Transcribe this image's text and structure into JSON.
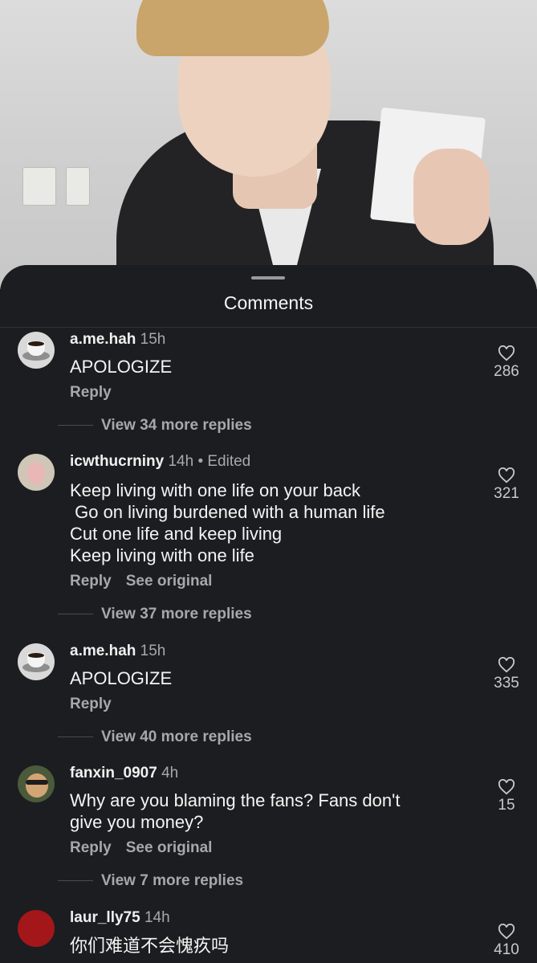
{
  "sheet": {
    "title": "Comments"
  },
  "comments": [
    {
      "username": "a.me.hah",
      "time": "15h",
      "lines": [
        "APOLOGIZE"
      ],
      "actions": {
        "reply": "Reply"
      },
      "likes": "286",
      "view_replies": "View 34 more replies",
      "avatar": "coffee-cup-icon"
    },
    {
      "username": "icwthucrniny",
      "time": "14h • Edited",
      "lines": [
        "Keep living with one life on your back",
        " Go on living burdened with a human life",
        "Cut one life and keep living",
        "Keep living with one life"
      ],
      "actions": {
        "reply": "Reply",
        "see_original": "See original"
      },
      "likes": "321",
      "view_replies": "View 37 more replies",
      "avatar": "pink-figure-icon"
    },
    {
      "username": "a.me.hah",
      "time": "15h",
      "lines": [
        "APOLOGIZE"
      ],
      "actions": {
        "reply": "Reply"
      },
      "likes": "335",
      "view_replies": "View 40 more replies",
      "avatar": "coffee-cup-icon"
    },
    {
      "username": "fanxin_0907",
      "time": "4h",
      "lines": [
        "Why are you blaming the fans? Fans don't",
        "give you money?"
      ],
      "actions": {
        "reply": "Reply",
        "see_original": "See original"
      },
      "likes": "15",
      "view_replies": "View 7 more replies",
      "avatar": "glasses-face-icon"
    },
    {
      "username": "laur_lly75",
      "time": "14h",
      "lines": [
        "你们难道不会愧疚吗"
      ],
      "likes": "410",
      "avatar": "red-circle-icon"
    }
  ],
  "colors": {
    "sheet_bg": "#1c1d20",
    "muted": "#a7a8ac"
  }
}
